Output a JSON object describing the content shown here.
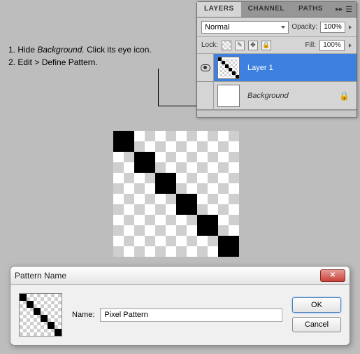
{
  "instructions": {
    "line1_pre": "1. Hide ",
    "line1_it": "Background.",
    "line1_post": " Click its eye icon.",
    "line2": "2. Edit > Define Pattern."
  },
  "panel": {
    "tabs": {
      "layers": "LAYERS",
      "channel": "CHANNEL",
      "paths": "PATHS"
    },
    "menu_arrows": "▸▸",
    "blend_mode": "Normal",
    "opacity_label": "Opacity:",
    "opacity_value": "100%",
    "lock_label": "Lock:",
    "fill_label": "Fill:",
    "fill_value": "100%",
    "layer1_name": "Layer 1",
    "bg_name": "Background"
  },
  "dialog": {
    "title": "Pattern Name",
    "name_label": "Name:",
    "name_value": "Pixel Pattern",
    "ok": "OK",
    "cancel": "Cancel"
  }
}
